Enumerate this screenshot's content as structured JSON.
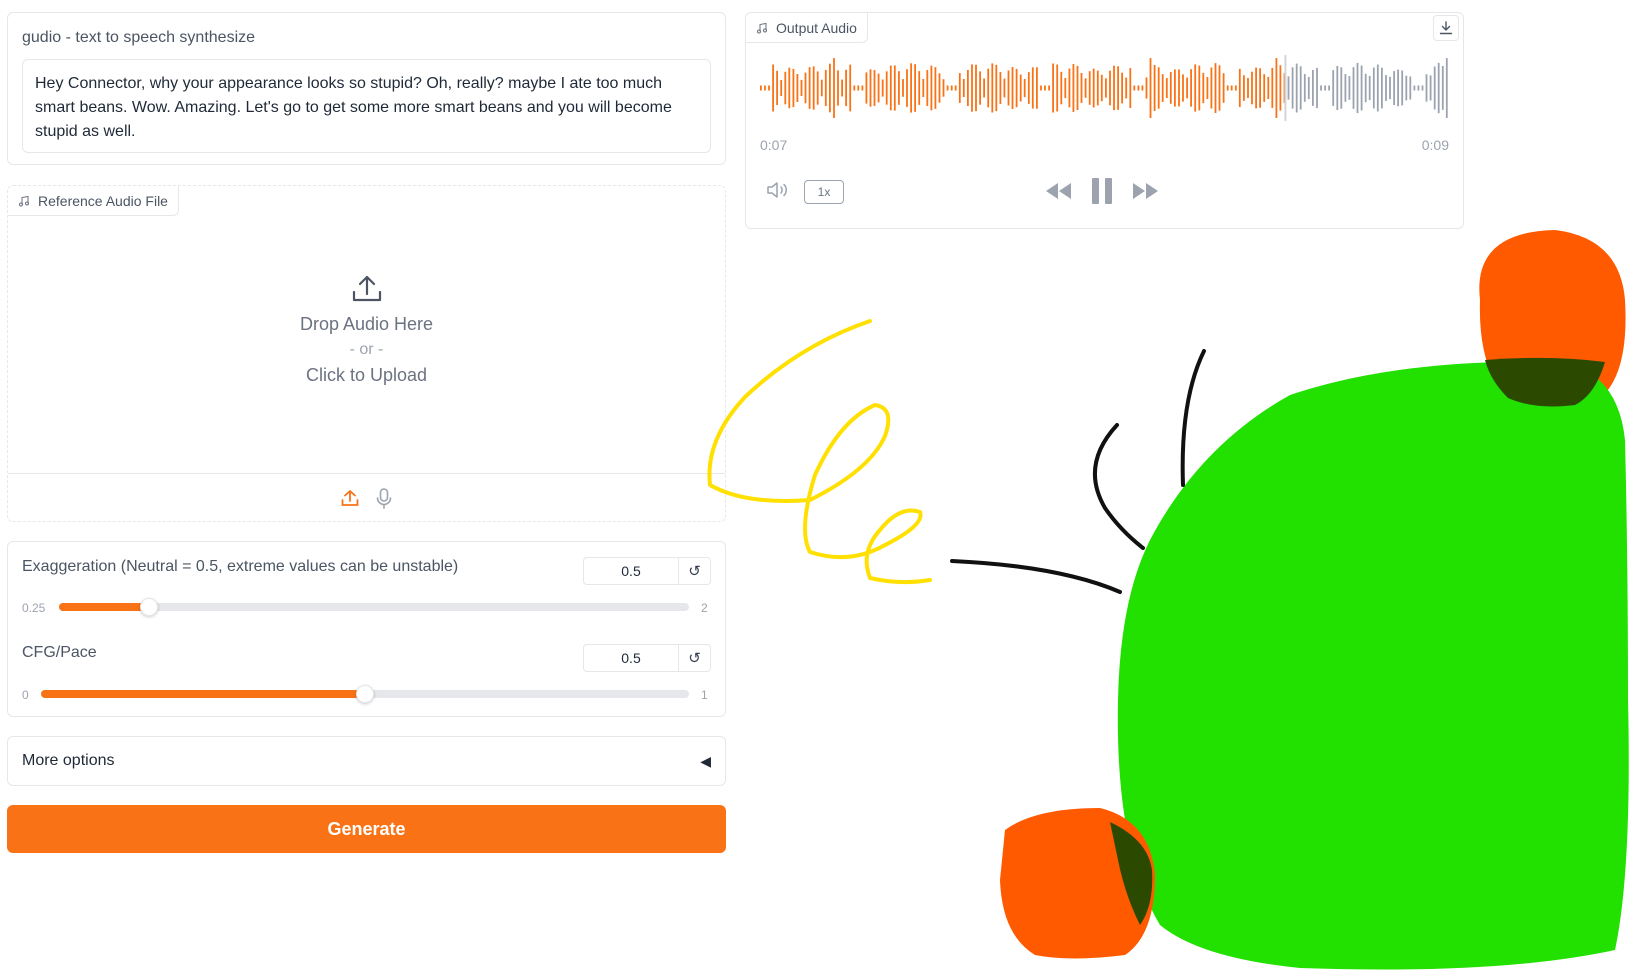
{
  "text_input": {
    "label": "gudio - text to speech synthesize",
    "value": "Hey Connector, why your appearance looks so stupid? Oh, really? maybe I ate too much smart beans. Wow. Amazing. Let's go to get some more smart beans and you will become stupid as well."
  },
  "reference_audio": {
    "label": "Reference Audio File",
    "drop_text": "Drop Audio Here",
    "or_text": "- or -",
    "click_text": "Click to Upload",
    "icons": [
      "upload-icon",
      "microphone-icon"
    ]
  },
  "sliders": [
    {
      "label": "Exaggeration (Neutral = 0.5, extreme values can be unstable)",
      "value": "0.5",
      "min": "0.25",
      "max": "2",
      "fraction": 0.143
    },
    {
      "label": "CFG/Pace",
      "value": "0.5",
      "min": "0",
      "max": "1",
      "fraction": 0.5
    }
  ],
  "more_options": {
    "label": "More options",
    "arrow": "◀"
  },
  "generate": {
    "label": "Generate"
  },
  "output_audio": {
    "label": "Output Audio",
    "time_current": "0:07",
    "time_total": "0:09",
    "speed": "1x",
    "progress": 0.76,
    "played_color": "#f97316",
    "unplayed_color": "#9ca3af"
  },
  "colors": {
    "accent": "#f97316",
    "doodle_green": "#22e000",
    "doodle_orange": "#ff5a00",
    "doodle_yellow": "#ffe000"
  }
}
